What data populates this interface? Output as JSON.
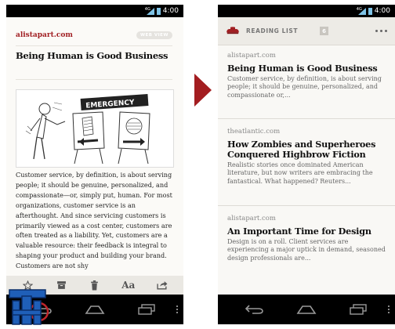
{
  "left_phone": {
    "status_time": "4:00",
    "signal_label": "4G",
    "source": "alistapart.com",
    "webview_badge": "WEB VIEW",
    "headline": "Being Human is Good Business",
    "illustration_sign": "EMERGENCY",
    "body": "Customer service, by definition, is about serving people; it should be genuine, personalized, and compassionate—or, simply put, human. For most organizations, customer service is an afterthought. And since servicing customers is primarily viewed as a cost center, customers are often treated as a liability. Yet, customers are a valuable resource: their feedback is integral to shaping your product and building your brand. Customers are not shy",
    "toolbar": {
      "star_icon": "star-icon",
      "archive_icon": "archive-icon",
      "trash_icon": "trash-icon",
      "font_label": "Aa",
      "share_icon": "share-icon"
    }
  },
  "right_phone": {
    "status_time": "4:00",
    "signal_label": "4G",
    "appbar": {
      "title": "READING LIST",
      "count": "6"
    },
    "items": [
      {
        "source": "alistapart.com",
        "title": "Being Human is Good Business",
        "excerpt": "Customer service, by definition, is about serving people; it should be genuine, personalized, and compassionate or,..."
      },
      {
        "source": "theatlantic.com",
        "title": "How Zombies and Superheroes Conquered Highbrow Fiction",
        "excerpt": "Realistic stories once dominated American literature, but now writers are embracing the fantastical. What happened? Reuters..."
      },
      {
        "source": "alistapart.com",
        "title": "An Important Time for Design",
        "excerpt": "Design is on a roll. Client services are experiencing a major uptick in demand, seasoned design professionals are..."
      }
    ]
  },
  "colors": {
    "accent_red": "#a11f23",
    "status_blue": "#7fc3e6",
    "watermark_blue": "#1f5fb8"
  }
}
